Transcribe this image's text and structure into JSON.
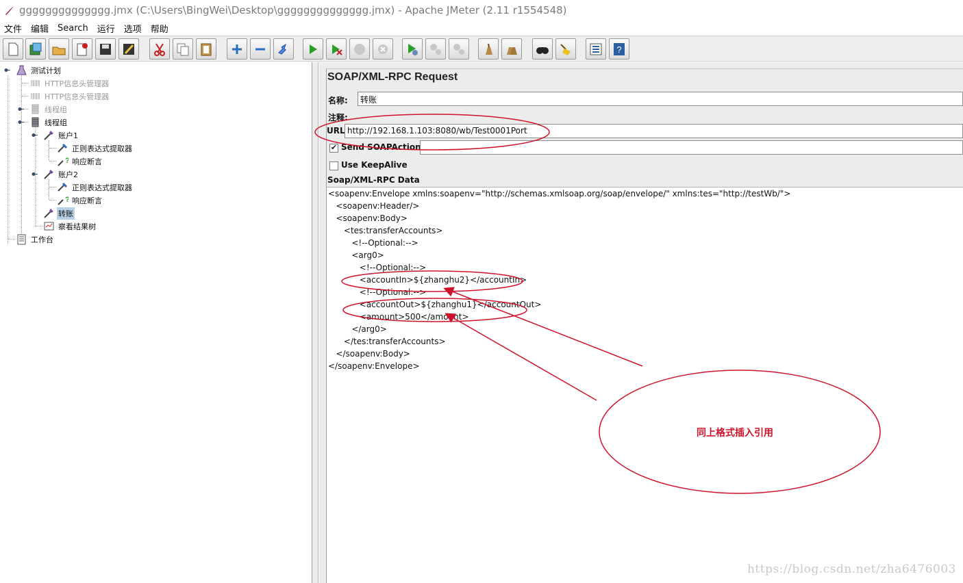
{
  "window": {
    "title": "gggggggggggggg.jmx (C:\\Users\\BingWei\\Desktop\\gggggggggggggg.jmx) - Apache JMeter (2.11 r1554548)"
  },
  "menu": [
    "文件",
    "编辑",
    "Search",
    "运行",
    "选项",
    "帮助"
  ],
  "toolbar": {
    "buttons": [
      "new-icon",
      "templates-icon",
      "open-icon",
      "close-icon",
      "save-icon",
      "save-screenshot-icon",
      "cut-icon",
      "copy-icon",
      "paste-icon",
      "expand-icon",
      "collapse-icon",
      "toggle-icon",
      "start-icon",
      "start-no-pause-icon",
      "stop-icon",
      "shutdown-icon",
      "remote-start-icon",
      "remote-stop-icon",
      "remote-shutdown-icon",
      "clear-icon",
      "clear-all-icon",
      "search-icon",
      "reset-search-icon",
      "function-helper-icon",
      "help-icon"
    ]
  },
  "tree": {
    "items": [
      {
        "label": "测试计划",
        "icon": "test-plan-icon",
        "disabled": false,
        "selected": false
      },
      {
        "label": "HTTP信息头管理器",
        "icon": "config-element-icon",
        "disabled": true,
        "selected": false
      },
      {
        "label": "HTTP信息头管理器",
        "icon": "config-element-icon",
        "disabled": true,
        "selected": false
      },
      {
        "label": "线程组",
        "icon": "thread-group-icon",
        "disabled": true,
        "selected": false
      },
      {
        "label": "线程组",
        "icon": "thread-group-icon",
        "disabled": false,
        "selected": false
      },
      {
        "label": "账户1",
        "icon": "sampler-icon",
        "disabled": false,
        "selected": false
      },
      {
        "label": "正则表达式提取器",
        "icon": "post-processor-icon",
        "disabled": false,
        "selected": false
      },
      {
        "label": "响应断言",
        "icon": "assertion-icon",
        "disabled": false,
        "selected": false
      },
      {
        "label": "账户2",
        "icon": "sampler-icon",
        "disabled": false,
        "selected": false
      },
      {
        "label": "正则表达式提取器",
        "icon": "post-processor-icon",
        "disabled": false,
        "selected": false
      },
      {
        "label": "响应断言",
        "icon": "assertion-icon",
        "disabled": false,
        "selected": false
      },
      {
        "label": "转账",
        "icon": "sampler-icon",
        "disabled": false,
        "selected": true
      },
      {
        "label": "察看结果树",
        "icon": "listener-icon",
        "disabled": false,
        "selected": false
      },
      {
        "label": "工作台",
        "icon": "workbench-icon",
        "disabled": false,
        "selected": false
      }
    ]
  },
  "panel": {
    "title": "SOAP/XML-RPC Request",
    "name_label": "名称:",
    "name_value": "转账",
    "comment_label": "注释:",
    "url_label": "URL",
    "url_value": "http://192.168.1.103:8080/wb/Test0001Port",
    "send_soapaction_label": "Send SOAPAction:",
    "send_soapaction_checked": true,
    "send_soapaction_value": "",
    "keepalive_label": "Use KeepAlive",
    "keepalive_checked": false,
    "data_label": "Soap/XML-RPC Data",
    "xml_lines": [
      "<soapenv:Envelope xmlns:soapenv=\"http://schemas.xmlsoap.org/soap/envelope/\" xmlns:tes=\"http://testWb/\">",
      "   <soapenv:Header/>",
      "   <soapenv:Body>",
      "      <tes:transferAccounts>",
      "         <!--Optional:-->",
      "         <arg0>",
      "            <!--Optional:-->",
      "            <accountIn>${zhanghu2}</accountIn>",
      "            <!--Optional:-->",
      "            <accountOut>${zhanghu1}</accountOut>",
      "            <amount>500</amount>",
      "         </arg0>",
      "      </tes:transferAccounts>",
      "   </soapenv:Body>",
      "</soapenv:Envelope>"
    ]
  },
  "annotation": {
    "text": "同上格式插入引用",
    "color": "#d0112b"
  },
  "watermark": "https://blog.csdn.net/zha6476003"
}
